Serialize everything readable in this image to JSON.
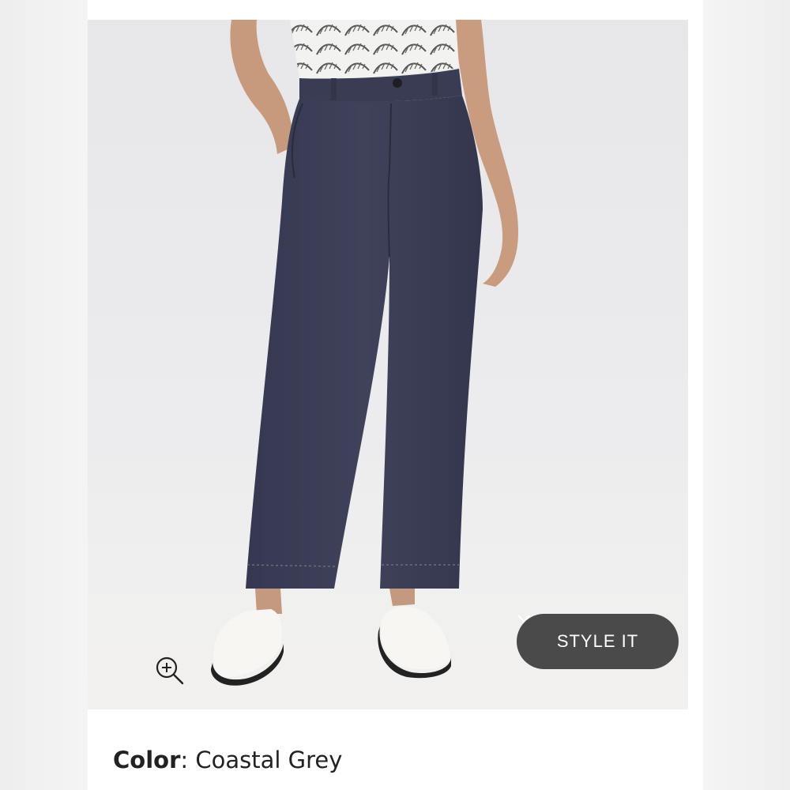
{
  "product": {
    "style_button_label": "STYLE IT",
    "color_label": "Color",
    "color_separator": ":",
    "color_value": "Coastal Grey"
  },
  "icons": {
    "zoom": "zoom-in-icon",
    "style_chevron": "chevron-down-icon"
  },
  "colors": {
    "pants": "#3b3d55",
    "button_bg": "#4a4a4a"
  }
}
